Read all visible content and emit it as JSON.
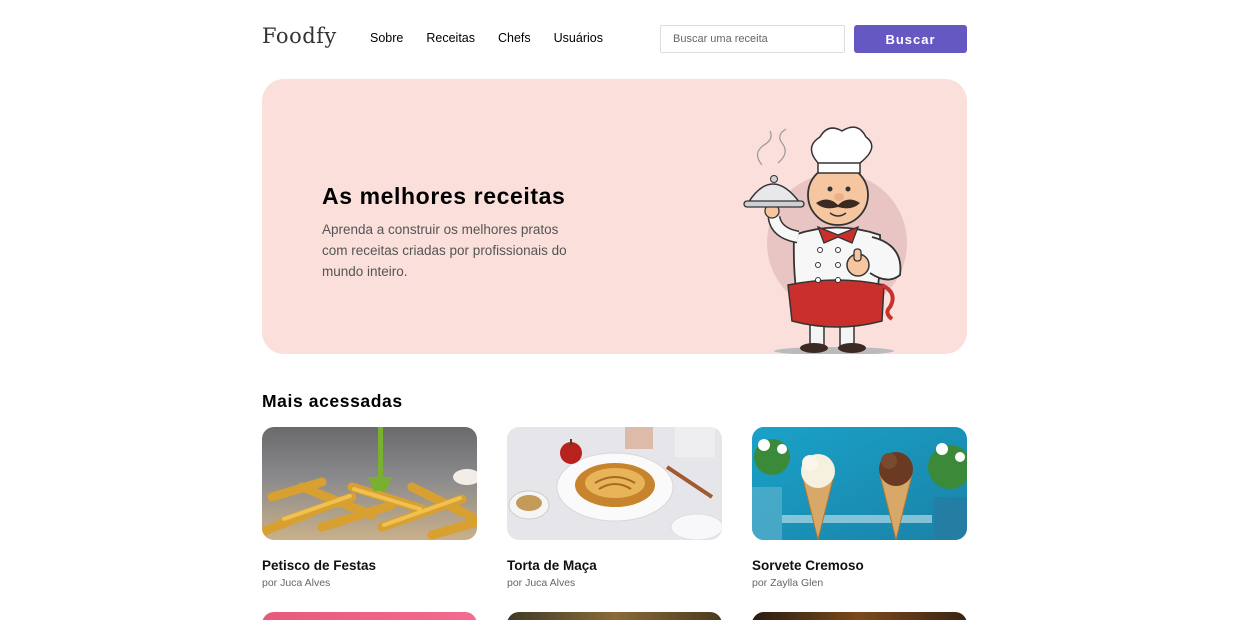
{
  "header": {
    "logo": "Foodfy",
    "nav": [
      {
        "label": "Sobre"
      },
      {
        "label": "Receitas"
      },
      {
        "label": "Chefs"
      },
      {
        "label": "Usuários"
      }
    ],
    "search": {
      "placeholder": "Buscar uma receita",
      "button_label": "Buscar"
    }
  },
  "hero": {
    "title": "As melhores receitas",
    "text": "Aprenda a construir os melhores pratos com receitas criadas por profissionais do mundo inteiro."
  },
  "section": {
    "title": "Mais acessadas"
  },
  "recipes": [
    {
      "title": "Petisco de Festas",
      "author": "por Juca Alves"
    },
    {
      "title": "Torta de Maça",
      "author": "por Juca Alves"
    },
    {
      "title": "Sorvete Cremoso",
      "author": "por Zaylla Glen"
    }
  ],
  "colors": {
    "accent": "#6558c3",
    "hero_bg": "#fadfdb"
  }
}
